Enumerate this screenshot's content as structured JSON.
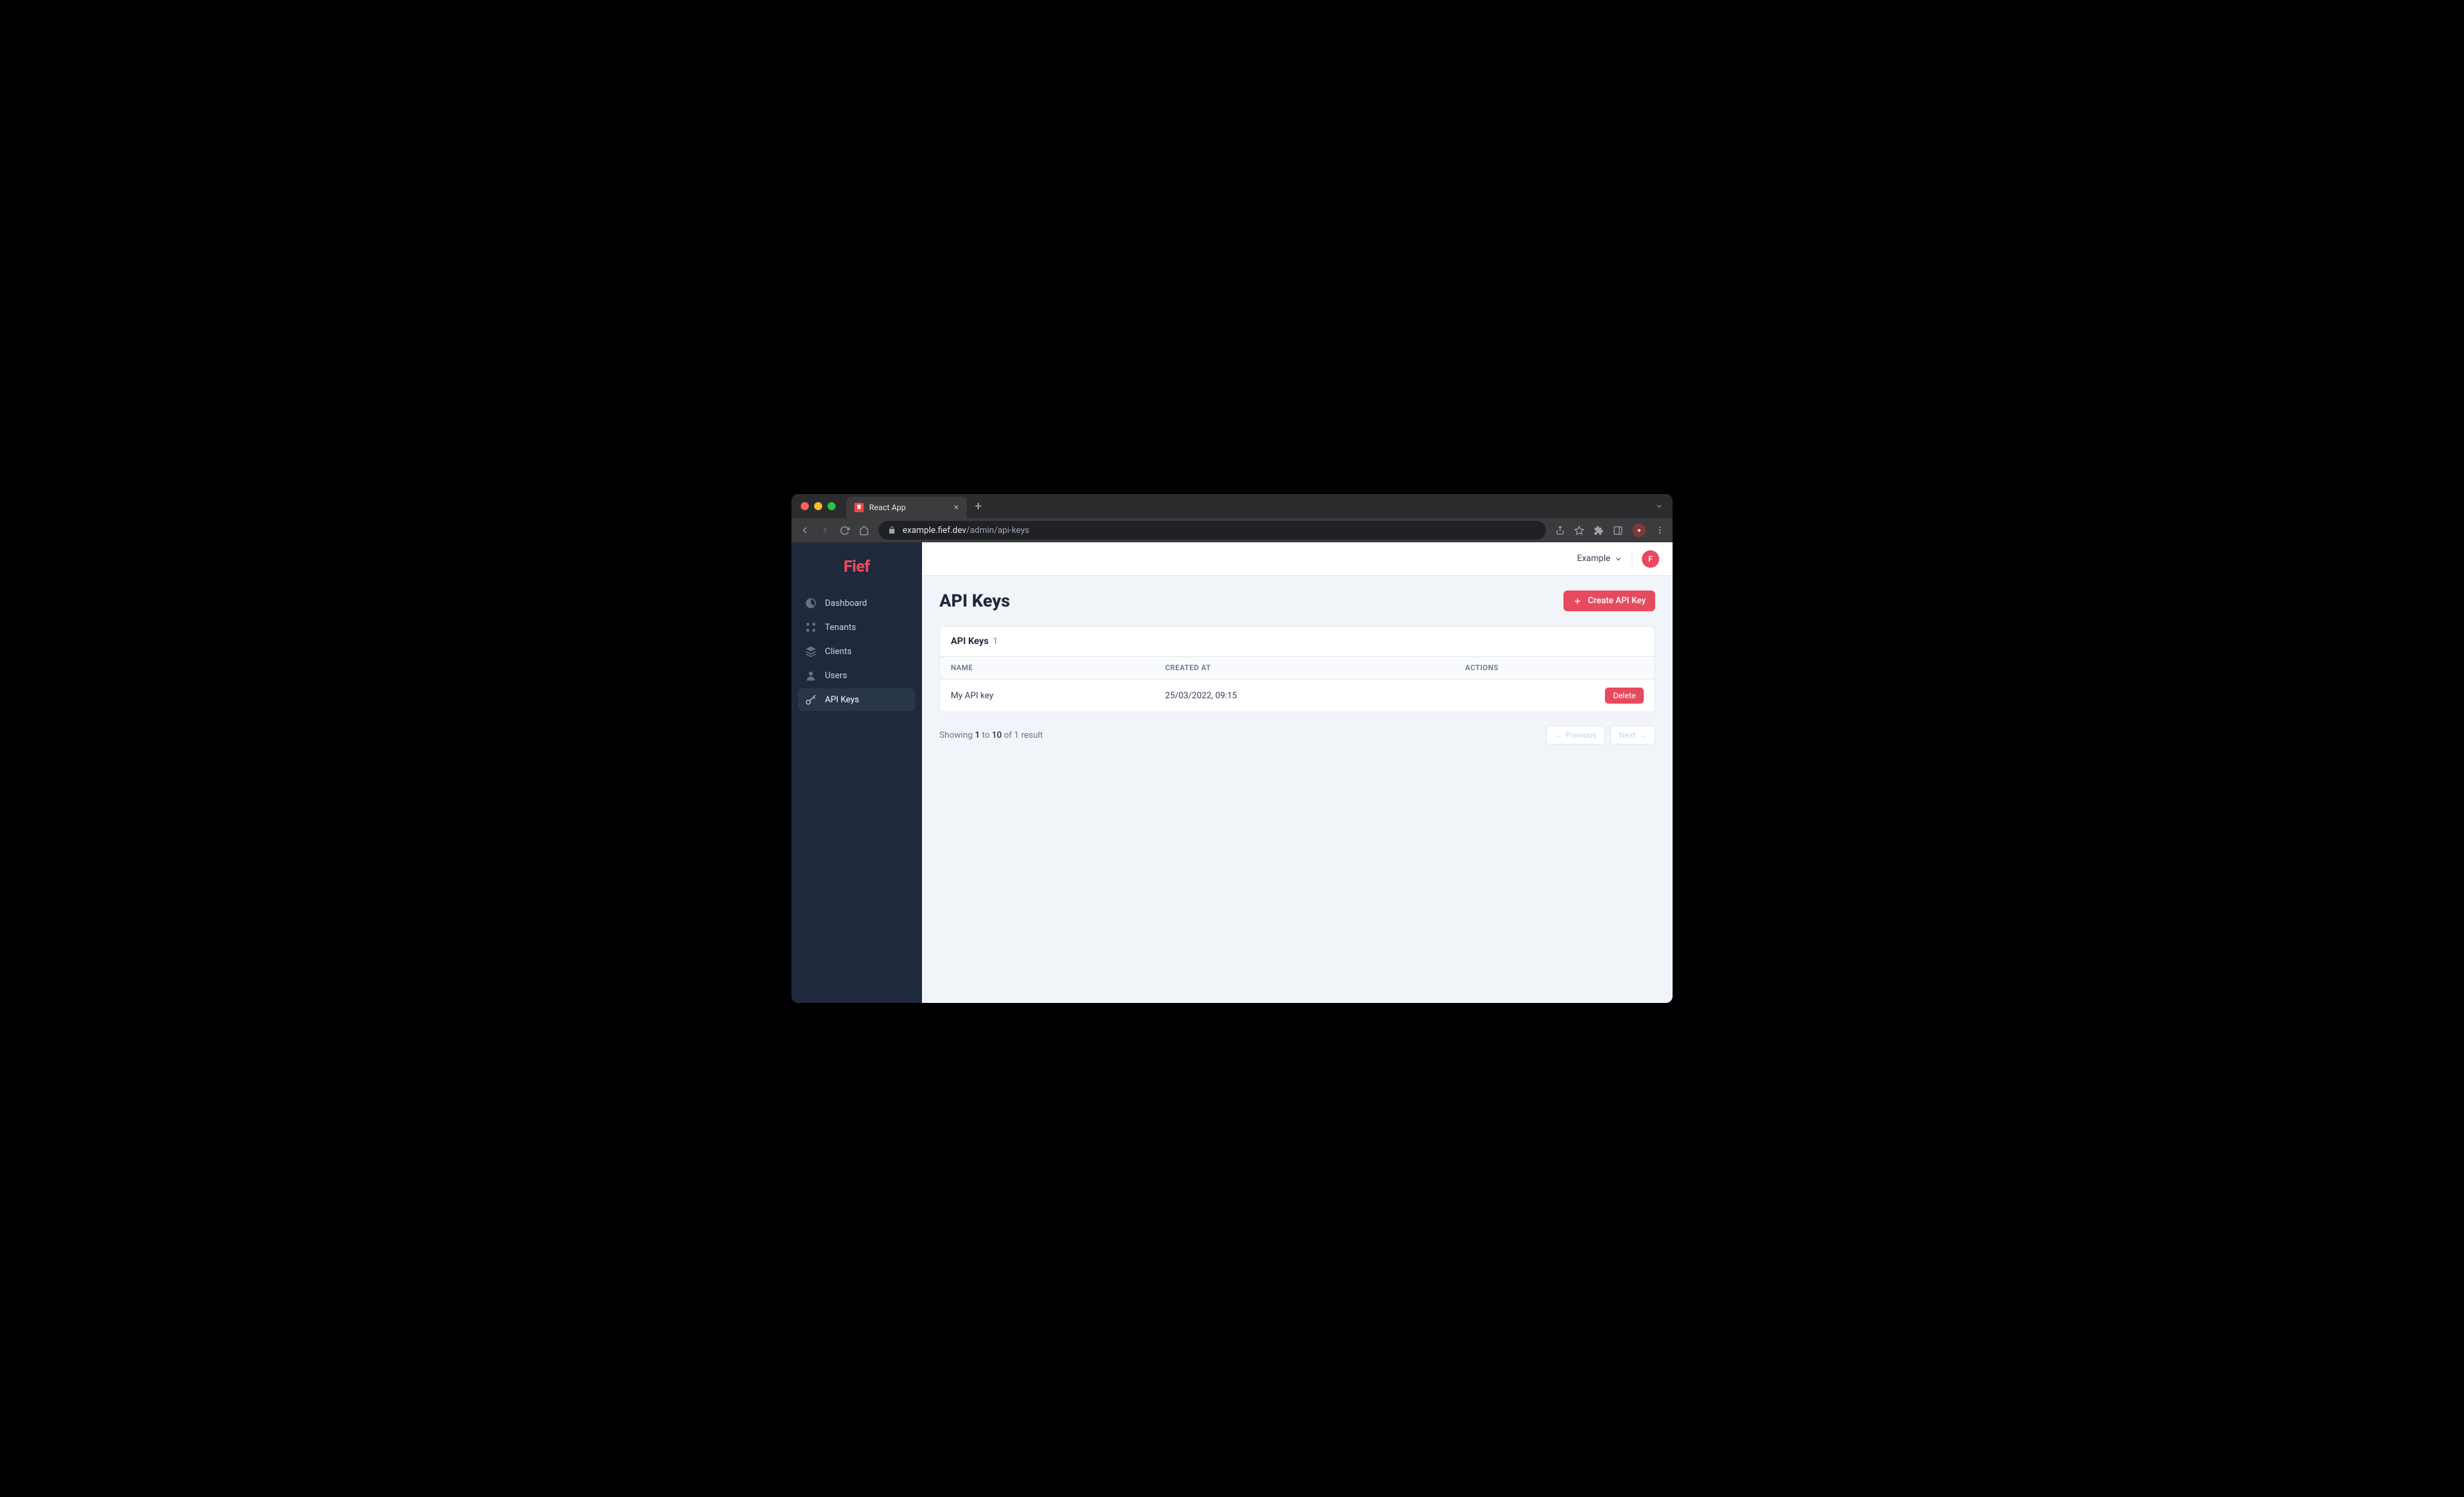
{
  "browser": {
    "tab_title": "React App",
    "url_domain": "example.fief.dev",
    "url_path": "/admin/api-keys"
  },
  "brand": {
    "name": "Fief"
  },
  "sidebar": {
    "items": [
      {
        "label": "Dashboard",
        "icon": "gauge"
      },
      {
        "label": "Tenants",
        "icon": "tenants"
      },
      {
        "label": "Clients",
        "icon": "layers"
      },
      {
        "label": "Users",
        "icon": "user"
      },
      {
        "label": "API Keys",
        "icon": "key"
      }
    ],
    "active_index": 4
  },
  "topbar": {
    "tenant_label": "Example",
    "avatar_initial": "F"
  },
  "page": {
    "title": "API Keys",
    "create_button": "Create API Key"
  },
  "table": {
    "header_title": "API Keys",
    "count": "1",
    "columns": [
      "NAME",
      "CREATED AT",
      "ACTIONS"
    ],
    "rows": [
      {
        "name": "My API key",
        "created_at": "25/03/2022, 09:15",
        "action_label": "Delete"
      }
    ]
  },
  "pagination": {
    "showing_prefix": "Showing",
    "from": "1",
    "to_word": "to",
    "to": "10",
    "of_word": "of",
    "total": "1",
    "result_word": "result",
    "prev_label": "Previous",
    "next_label": "Next"
  },
  "colors": {
    "accent": "#e74a5f",
    "sidebar_bg": "#1e293b",
    "main_bg": "#f1f5f9"
  }
}
